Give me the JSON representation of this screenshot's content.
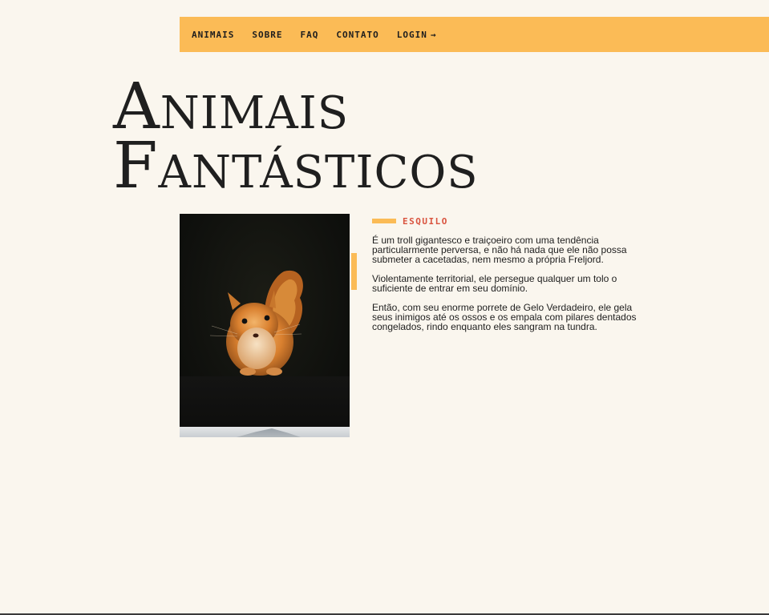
{
  "nav": {
    "items": [
      {
        "label": "ANIMAIS"
      },
      {
        "label": "SOBRE"
      },
      {
        "label": "FAQ"
      },
      {
        "label": "CONTATO"
      },
      {
        "label": "LOGIN",
        "icon": "arrow-right-icon",
        "glyph": "→"
      }
    ]
  },
  "hero": {
    "title_line1": "Animais",
    "title_line2": "Fantásticos"
  },
  "animal": {
    "label": "ESQUILO",
    "image": "squirrel-photo",
    "paragraphs": [
      "É um troll gigantesco e traiçoeiro com uma tendência particularmente perversa, e não há nada que ele não possa submeter a cacetadas, nem mesmo a própria Freljord.",
      "Violentamente territorial, ele persegue qualquer um tolo o suficiente de entrar em seu domínio.",
      "Então, com seu enorme porrete de Gelo Verdadeiro, ele gela seus inimigos até os ossos e os empala com pilares dentados congelados, rindo enquanto eles sangram na tundra."
    ]
  },
  "colors": {
    "background": "#faf6ee",
    "accent": "#fbbb56",
    "label": "#d9533e",
    "text": "#1e1e1e"
  }
}
